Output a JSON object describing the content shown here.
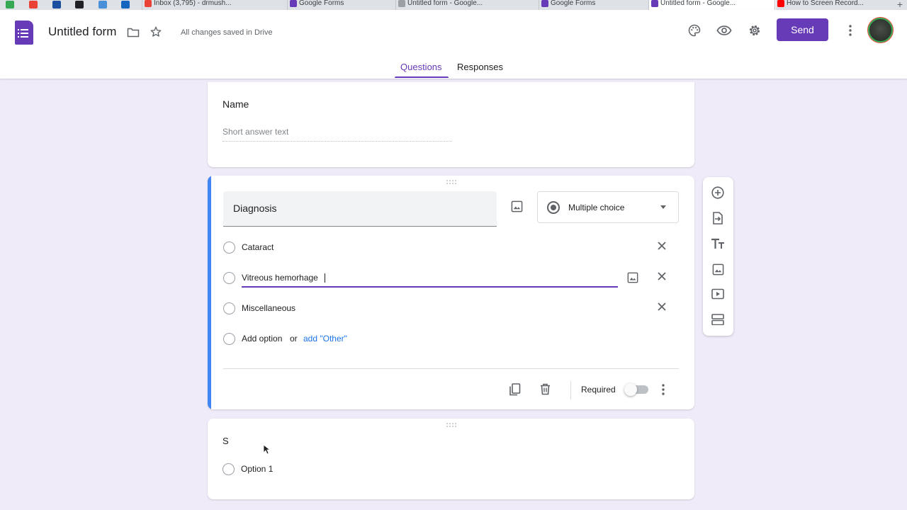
{
  "browser": {
    "tabs": [
      {
        "label": "Inbox (3,795) - drmush...",
        "icon": "gmail-icon",
        "color": "#ea4335"
      },
      {
        "label": "Google Forms",
        "icon": "forms-icon",
        "color": "#673ab7"
      },
      {
        "label": "Untitled form - Google...",
        "icon": "google-icon",
        "color": "#5f6368"
      },
      {
        "label": "Google Forms",
        "icon": "forms-icon",
        "color": "#673ab7"
      },
      {
        "label": "Untitled form - Google...",
        "icon": "forms-icon",
        "color": "#673ab7",
        "active": true
      },
      {
        "label": "How to Screen Record...",
        "icon": "youtube-icon",
        "color": "#ff0000"
      }
    ],
    "new_tab": "+"
  },
  "header": {
    "title": "Untitled form",
    "save_status": "All changes saved in Drive",
    "send_label": "Send",
    "icons": [
      "folder-icon",
      "star-icon",
      "palette-icon",
      "preview-eye-icon",
      "settings-gear-icon",
      "more-vert-icon"
    ]
  },
  "tabs": {
    "questions": "Questions",
    "responses": "Responses"
  },
  "cards": {
    "name_question": {
      "title": "Name",
      "answer_placeholder": "Short answer text"
    },
    "diagnosis_question": {
      "title": "Diagnosis",
      "type": "Multiple choice",
      "options": [
        "Cataract",
        "Vitreous hemorhage",
        "Miscellaneous"
      ],
      "add_option": "Add option",
      "or": "or",
      "add_other": "add \"Other\"",
      "required_label": "Required",
      "required": false
    },
    "third_question": {
      "title": "S",
      "options": [
        "Option 1"
      ]
    }
  },
  "sidebar": {
    "tools": [
      "add-question-icon",
      "import-questions-icon",
      "add-title-icon",
      "add-image-icon",
      "add-video-icon",
      "add-section-icon"
    ]
  },
  "colors": {
    "accent": "#673ab7",
    "background": "#f0ebf8",
    "active_card_bar": "#4285f4",
    "link": "#1a73e8"
  }
}
